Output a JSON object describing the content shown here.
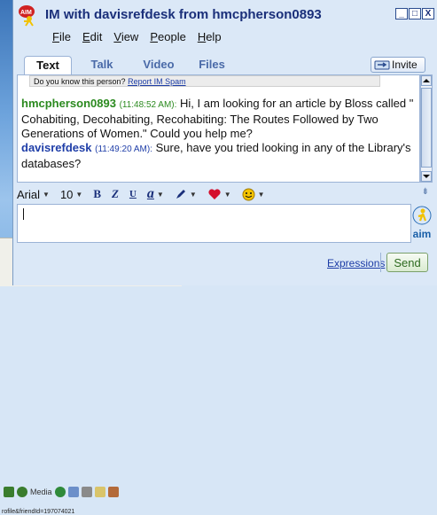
{
  "window": {
    "title": "IM with davisrefdesk from hmcpherson0893",
    "buttons": [
      "_",
      "□",
      "X"
    ]
  },
  "menu": {
    "items": [
      {
        "label": "File",
        "u": "F",
        "rest": "ile"
      },
      {
        "label": "Edit",
        "u": "E",
        "rest": "dit"
      },
      {
        "label": "View",
        "u": "V",
        "rest": "iew"
      },
      {
        "label": "People",
        "u": "P",
        "rest": "eople"
      },
      {
        "label": "Help",
        "u": "H",
        "rest": "elp"
      }
    ]
  },
  "tabs": {
    "text": "Text",
    "talk": "Talk",
    "video": "Video",
    "files": "Files",
    "invite": "Invite"
  },
  "knowbar": {
    "question": "Do you know this person?",
    "link": "Report IM Spam"
  },
  "messages": [
    {
      "sender": "hmcpherson0893",
      "time": "(11:48:52 AM):",
      "text": " Hi, I am looking for an article by Bloss called \" Cohabiting, Decohabiting, Recohabiting: The Routes Followed by Two Generations of Women.\"  Could you help me?"
    },
    {
      "sender": "davisrefdesk",
      "time": "(11:49:20 AM):",
      "text": " Sure, have you tried looking in any of the Library's databases?"
    }
  ],
  "format": {
    "font": "Arial",
    "size": "10",
    "bold": "B",
    "italic": "Z",
    "underline": "U",
    "text_color": "a"
  },
  "side": {
    "aim_label": "aim"
  },
  "bottom": {
    "expressions": "Expressions",
    "send": "Send"
  },
  "background": {
    "media_label": "Media",
    "address_fragment": "rofile&friendId=197074021"
  },
  "colors": {
    "title": "#1a2f7a",
    "sender_them": "#2b8a1f",
    "sender_me": "#1f3ea8",
    "send_green": "#2d6a1f"
  },
  "icons": [
    "aim-running-man-icon",
    "invite-icon",
    "pen-icon",
    "heart-icon",
    "smiley-icon",
    "aim-side-icon",
    "down-arrow-icon",
    "up-arrow-icon"
  ]
}
